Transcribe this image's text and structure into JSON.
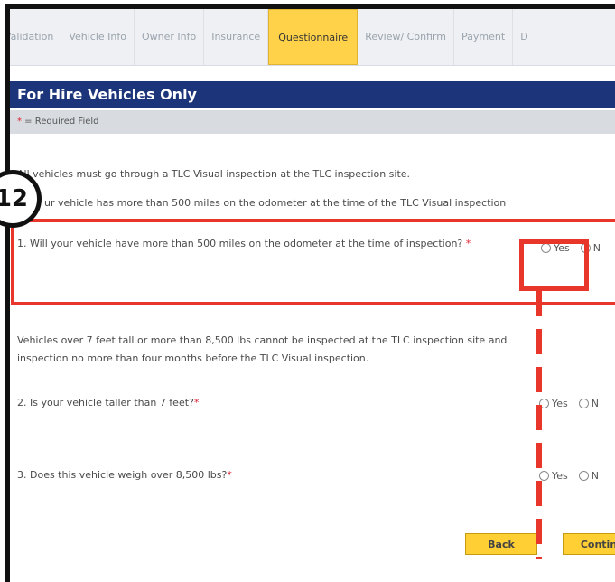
{
  "tabs": [
    {
      "label": "Validation",
      "active": false
    },
    {
      "label": "Vehicle Info",
      "active": false
    },
    {
      "label": "Owner Info",
      "active": false
    },
    {
      "label": "Insurance",
      "active": false
    },
    {
      "label": "Questionnaire",
      "active": true
    },
    {
      "label": "Review/ Confirm",
      "active": false
    },
    {
      "label": "Payment",
      "active": false
    },
    {
      "label": "D",
      "active": false
    }
  ],
  "section_title": "For Hire Vehicles Only",
  "required_note": {
    "star": "*",
    "text": " = Required Field"
  },
  "intro_text": "All vehicles must go through a TLC Visual inspection at the TLC inspection site.",
  "intro_text_2": "ur vehicle has more than 500 miles on the odometer at the time of the TLC Visual inspection",
  "questions": [
    {
      "text": "1. Will your vehicle have more than 500 miles on the odometer at the time of inspection?",
      "star": "*",
      "yes": "Yes",
      "no": "N"
    },
    {
      "text": "2. Is your vehicle taller than 7 feet?",
      "star": "*",
      "yes": "Yes",
      "no": "N"
    },
    {
      "text": "3. Does this vehicle weigh over 8,500 lbs?",
      "star": "*",
      "yes": "Yes",
      "no": "N"
    }
  ],
  "weight_note_1": "Vehicles over 7 feet tall or more than 8,500 lbs cannot be inspected at the TLC inspection site and",
  "weight_note_2": "inspection no more than four months before the TLC Visual inspection.",
  "buttons": {
    "back": "Back",
    "continue": "Contin"
  },
  "annotation": {
    "step_number": "12",
    "color": "#e8362a"
  },
  "colors": {
    "header_bg": "#1c347a",
    "active_tab": "#ffd24a",
    "button": "#ffcf33"
  }
}
